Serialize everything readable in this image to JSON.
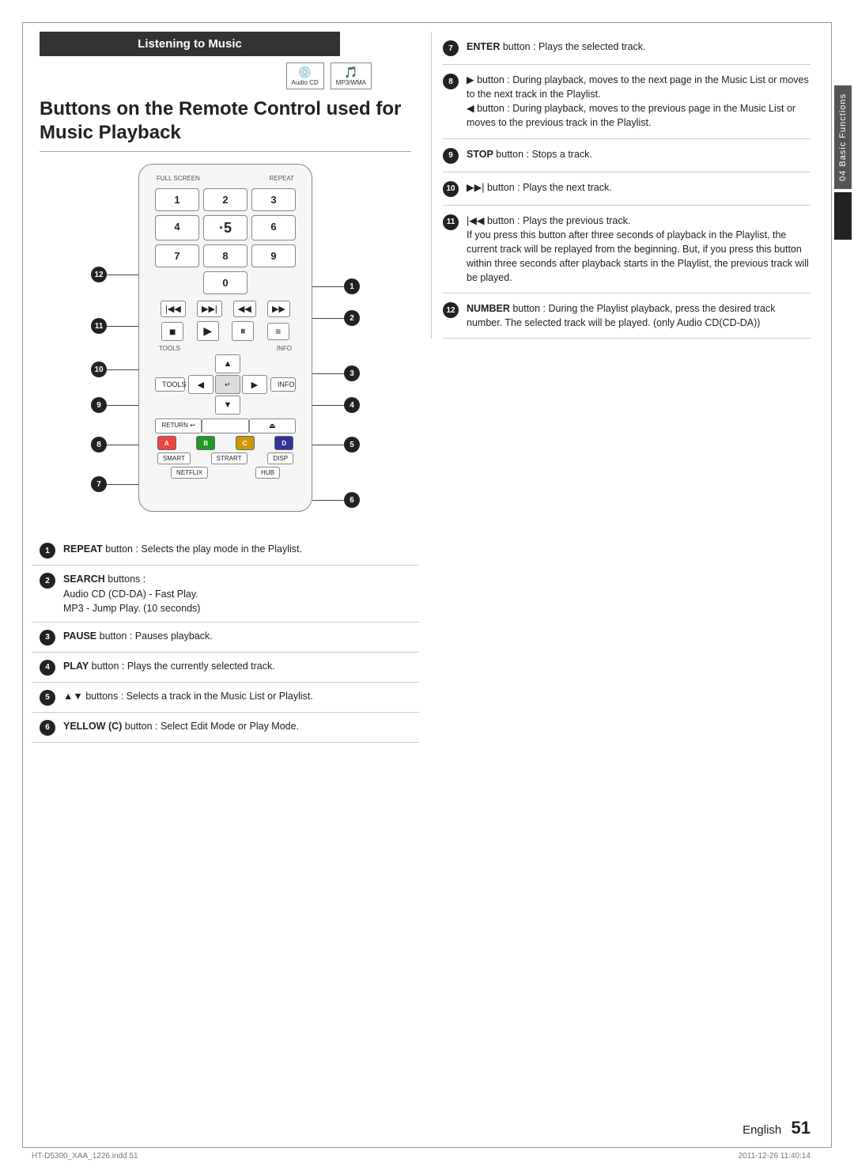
{
  "page": {
    "title": "Buttons on the Remote Control used for Music Playback",
    "section_header": "Listening to Music",
    "chapter": "04  Basic Functions",
    "page_number": "51",
    "page_number_prefix": "English",
    "footer_left": "HT-D5300_XAA_1226.indd   51",
    "footer_right": "2011-12-26     11:40:14"
  },
  "media_icons": [
    {
      "label": "Audio CD",
      "sub": ""
    },
    {
      "label": "MP3/WMA",
      "sub": ""
    }
  ],
  "callout_items_bottom": [
    {
      "num": "1",
      "text_bold": "REPEAT",
      "text": " button : Selects the play mode in the Playlist."
    },
    {
      "num": "2",
      "text_bold": "SEARCH",
      "text_intro": " buttons :\nAudio CD (CD-DA) - Fast Play.\nMP3 - Jump Play. (10 seconds)"
    },
    {
      "num": "3",
      "text_bold": "PAUSE",
      "text": " button : Pauses playback."
    },
    {
      "num": "4",
      "text_bold": "PLAY",
      "text": " button : Plays the currently selected track."
    },
    {
      "num": "5",
      "text_bold": "▲▼",
      "text": " buttons : Selects a track in the Music List or Playlist."
    },
    {
      "num": "6",
      "text_bold": "YELLOW (C)",
      "text": " button : Select Edit Mode or Play Mode."
    }
  ],
  "callout_items_right": [
    {
      "num": "7",
      "text": "ENTER button : Plays the selected track.",
      "bold_word": "ENTER"
    },
    {
      "num": "8",
      "text": "▶ button : During playback, moves to the next page in the Music List or moves to the next track in the Playlist.\n◀ button : During playback, moves to the previous page in the Music List or moves to the previous track in the Playlist.",
      "bold_word": ""
    },
    {
      "num": "9",
      "text": "STOP button : Stops a track.",
      "bold_word": "STOP"
    },
    {
      "num": "10",
      "text": "▶▶| button : Plays the next track.",
      "bold_word": ""
    },
    {
      "num": "11",
      "text": "|◀◀ button : Plays the previous track.\nIf you press this button after three seconds of playback in the Playlist, the current track will be replayed from the beginning. But, if you press this button within three seconds after playback starts in the Playlist, the previous track will be played.",
      "bold_word": ""
    },
    {
      "num": "12",
      "text": "NUMBER button : During the Playlist playback, press the desired track number. The selected track will be played. (only Audio CD(CD-DA))",
      "bold_word": "NUMBER"
    }
  ],
  "remote": {
    "numpad": [
      "1",
      "2",
      "3",
      "4",
      "·5",
      "6",
      "7",
      "8",
      "9",
      "0"
    ],
    "label_fullscreen": "FULL SCREEN",
    "label_repeat": "REPEAT",
    "transport_btns": [
      "|◀◀",
      "▶▶|",
      "◀◀",
      "▶▶"
    ],
    "playback_btns": [
      "■",
      "▶",
      "⏸",
      "≡⊞"
    ],
    "nav_labels_top": [
      "TOOLS",
      "INFO"
    ],
    "nav_up": "▲",
    "nav_down": "▼",
    "nav_left": "◀",
    "nav_right": "▶",
    "nav_center": "↵",
    "return_btns": [
      "RETURN ↩",
      "",
      "⏏"
    ],
    "color_btns": [
      {
        "letter": "A",
        "color": "#e44"
      },
      {
        "letter": "B",
        "color": "#292"
      },
      {
        "letter": "C",
        "color": "#eba500"
      },
      {
        "letter": "D",
        "color": "#339"
      }
    ],
    "bottom_btns": [
      "SMART",
      "STRART",
      "DISP"
    ],
    "bottom_row2": [
      "NETFLIX",
      "HUB"
    ]
  }
}
